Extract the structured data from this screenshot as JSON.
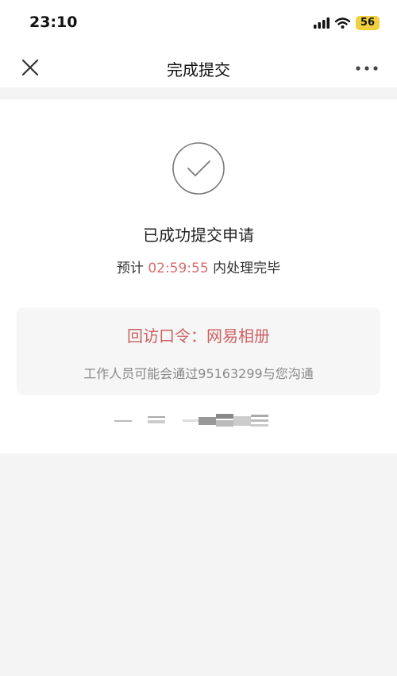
{
  "status_bar": {
    "time": "23:10",
    "battery": "56",
    "icons": [
      "signal-icon",
      "wifi-icon",
      "battery-icon"
    ]
  },
  "nav": {
    "title": "完成提交",
    "close_icon": "close-icon",
    "more_icon": "more-icon"
  },
  "result": {
    "icon": "check-circle-icon",
    "title": "已成功提交申请",
    "countdown_prefix": "预计",
    "countdown": "02:59:55",
    "countdown_suffix": "内处理完毕"
  },
  "info": {
    "password": "回访口令：网易相册",
    "contact": "工作人员可能会通过95163299与您沟通"
  },
  "colors": {
    "accent_red": "#cc6163",
    "countdown_red": "#d56e6e",
    "background": "#f4f4f4",
    "battery_yellow": "#f0d040"
  }
}
